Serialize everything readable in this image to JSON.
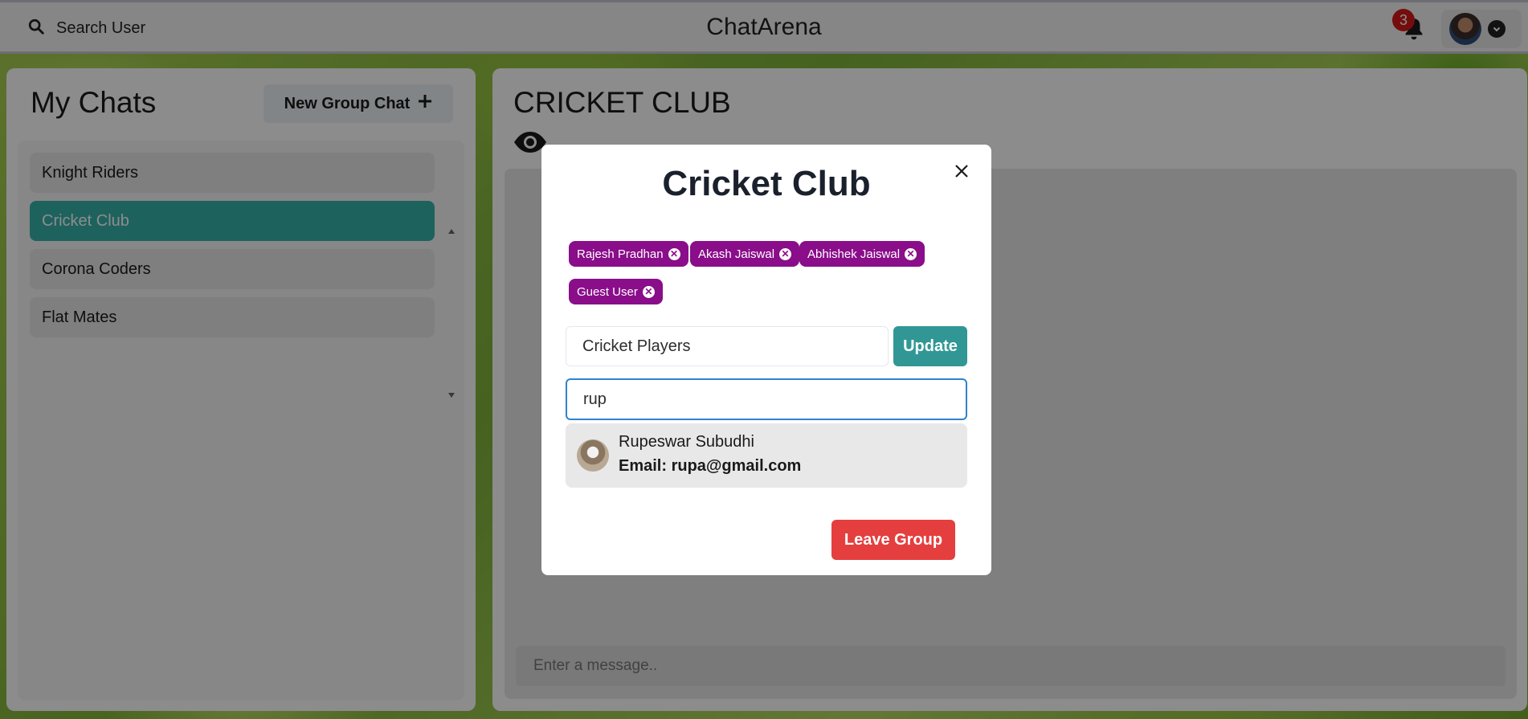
{
  "header": {
    "search_label": "Search User",
    "app_title": "ChatArena",
    "notification_count": "3"
  },
  "sidebar": {
    "title": "My Chats",
    "new_group_label": "New Group Chat",
    "chats": [
      {
        "label": "Knight Riders",
        "active": false
      },
      {
        "label": "Cricket Club",
        "active": true
      },
      {
        "label": "Corona Coders",
        "active": false
      },
      {
        "label": "Flat Mates",
        "active": false
      }
    ]
  },
  "chat": {
    "title": "CRICKET CLUB",
    "message_placeholder": "Enter a message.."
  },
  "modal": {
    "title": "Cricket Club",
    "members": [
      "Rajesh Pradhan",
      "Akash Jaiswal",
      "Abhishek Jaiswal",
      "Guest User"
    ],
    "rename_value": "Cricket Players",
    "update_label": "Update",
    "add_user_value": "rup",
    "search_result": {
      "name": "Rupeswar Subudhi",
      "email": "Email: rupa@gmail.com"
    },
    "leave_label": "Leave Group"
  },
  "colors": {
    "accent_teal": "#38b2ac",
    "chip_purple": "#8a0d8a",
    "danger_red": "#e53e3e",
    "update_teal": "#319795"
  }
}
